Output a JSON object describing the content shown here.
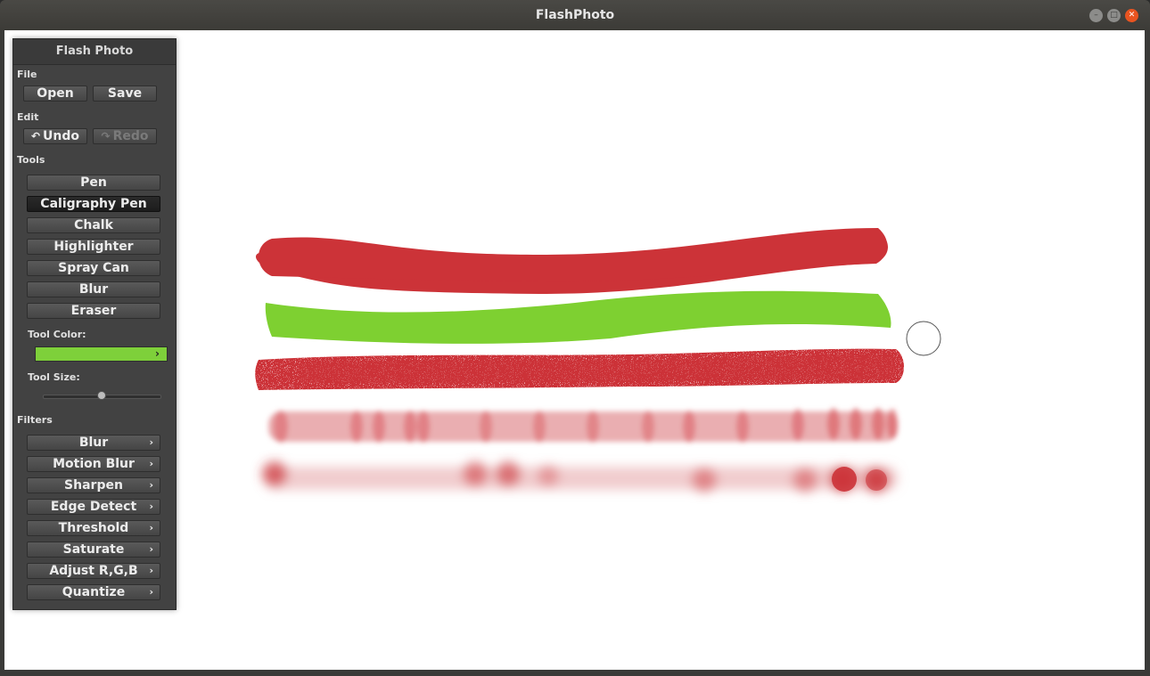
{
  "window": {
    "title": "FlashPhoto"
  },
  "panel": {
    "title": "Flash Photo",
    "file": {
      "label": "File",
      "open": "Open",
      "save": "Save"
    },
    "edit": {
      "label": "Edit",
      "undo": "Undo",
      "redo": "Redo"
    },
    "tools": {
      "label": "Tools",
      "items": [
        "Pen",
        "Caligraphy Pen",
        "Chalk",
        "Highlighter",
        "Spray Can",
        "Blur",
        "Eraser"
      ],
      "active": "Caligraphy Pen",
      "color_label": "Tool Color:",
      "color_value": "#7ed03a",
      "size_label": "Tool Size:",
      "size_fraction": 0.5
    },
    "filters": {
      "label": "Filters",
      "items": [
        "Blur",
        "Motion Blur",
        "Sharpen",
        "Edge Detect",
        "Threshold",
        "Saturate",
        "Adjust R,G,B",
        "Quantize"
      ]
    }
  },
  "colors": {
    "red": "#cc3338",
    "green": "#7ed031",
    "panel": "#424242"
  }
}
